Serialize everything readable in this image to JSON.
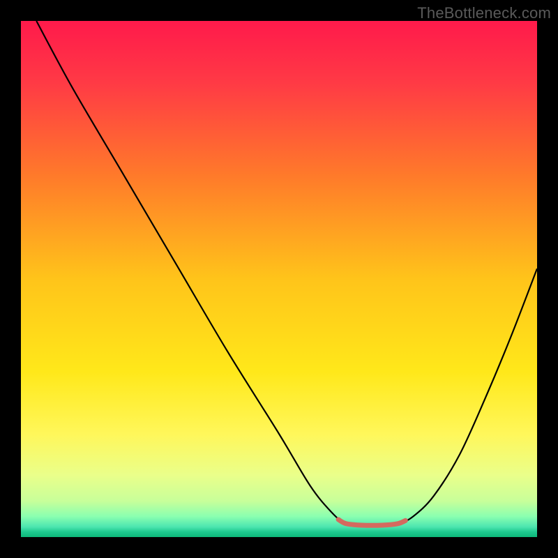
{
  "watermark": "TheBottleneck.com",
  "chart_data": {
    "type": "line",
    "title": "",
    "xlabel": "",
    "ylabel": "",
    "xlim": [
      0,
      100
    ],
    "ylim": [
      0,
      100
    ],
    "background_gradient_stops": [
      {
        "pct": 0,
        "color": "#ff1a4b"
      },
      {
        "pct": 12,
        "color": "#ff3a45"
      },
      {
        "pct": 30,
        "color": "#ff7a2a"
      },
      {
        "pct": 50,
        "color": "#ffc41a"
      },
      {
        "pct": 68,
        "color": "#ffe81a"
      },
      {
        "pct": 80,
        "color": "#fff75a"
      },
      {
        "pct": 88,
        "color": "#eaff8a"
      },
      {
        "pct": 93,
        "color": "#c8ff9a"
      },
      {
        "pct": 96,
        "color": "#8affb0"
      },
      {
        "pct": 98,
        "color": "#4de6b0"
      },
      {
        "pct": 99,
        "color": "#1ec98f"
      },
      {
        "pct": 100,
        "color": "#0db87a"
      }
    ],
    "series": [
      {
        "name": "bottleneck-curve",
        "color": "#000000",
        "width": 2.2,
        "points": [
          {
            "x": 3,
            "y": 100
          },
          {
            "x": 10,
            "y": 87
          },
          {
            "x": 20,
            "y": 70
          },
          {
            "x": 30,
            "y": 53
          },
          {
            "x": 40,
            "y": 36
          },
          {
            "x": 50,
            "y": 20
          },
          {
            "x": 56,
            "y": 10
          },
          {
            "x": 60,
            "y": 5
          },
          {
            "x": 63,
            "y": 2.5
          },
          {
            "x": 66,
            "y": 2.2
          },
          {
            "x": 70,
            "y": 2.2
          },
          {
            "x": 73,
            "y": 2.5
          },
          {
            "x": 76,
            "y": 4
          },
          {
            "x": 80,
            "y": 8
          },
          {
            "x": 85,
            "y": 16
          },
          {
            "x": 90,
            "y": 27
          },
          {
            "x": 95,
            "y": 39
          },
          {
            "x": 100,
            "y": 52
          }
        ]
      },
      {
        "name": "sweet-spot-marker",
        "color": "#d46a5f",
        "width": 7,
        "linecap": "round",
        "points": [
          {
            "x": 61.5,
            "y": 3.4
          },
          {
            "x": 63,
            "y": 2.6
          },
          {
            "x": 66,
            "y": 2.3
          },
          {
            "x": 70,
            "y": 2.3
          },
          {
            "x": 73,
            "y": 2.6
          },
          {
            "x": 74.5,
            "y": 3.2
          }
        ]
      }
    ]
  }
}
